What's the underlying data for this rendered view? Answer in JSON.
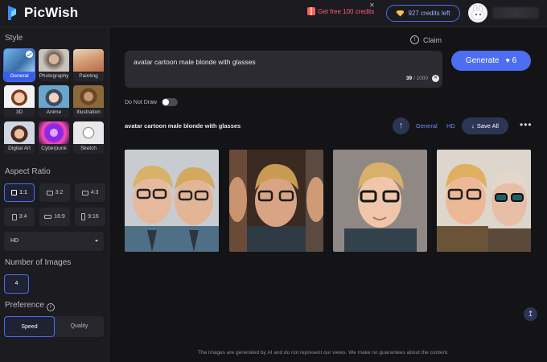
{
  "app": {
    "name": "PicWish"
  },
  "header": {
    "free_credits": "Get free 100 credits",
    "credits_left": "927 credits left"
  },
  "sidebar": {
    "style_title": "Style",
    "styles": [
      {
        "label": "General",
        "active": true
      },
      {
        "label": "Photography"
      },
      {
        "label": "Painting"
      },
      {
        "label": "3D"
      },
      {
        "label": "Anime"
      },
      {
        "label": "Illustration"
      },
      {
        "label": "Digital Art"
      },
      {
        "label": "Cyberpunk"
      },
      {
        "label": "Sketch"
      }
    ],
    "aspect_title": "Aspect Ratio",
    "ratios": [
      "1:1",
      "3:2",
      "4:3",
      "3:4",
      "16:9",
      "9:16"
    ],
    "quality_value": "HD",
    "num_images_title": "Number of Images",
    "num_images_value": "4",
    "preference_title": "Preference",
    "preference_options": [
      "Speed",
      "Quality"
    ]
  },
  "main": {
    "claim": "Claim",
    "prompt": "avatar cartoon male blonde with glasses",
    "counter_current": "39",
    "counter_max": "/ 1000",
    "generate_label": "Generate",
    "generate_cost": "6",
    "do_not_draw": "Do Not Draw",
    "result_title": "avatar cartoon male blonde with glasses",
    "tag_style": "General",
    "tag_quality": "HD",
    "save_all": "Save All",
    "disclaimer": "The images are generated by AI and do not represent our views. We make no guarantees about the content."
  },
  "colors": {
    "accent": "#4d6ef0",
    "background": "#141417",
    "panel": "#1b1b20",
    "promo": "#ff5a78"
  }
}
